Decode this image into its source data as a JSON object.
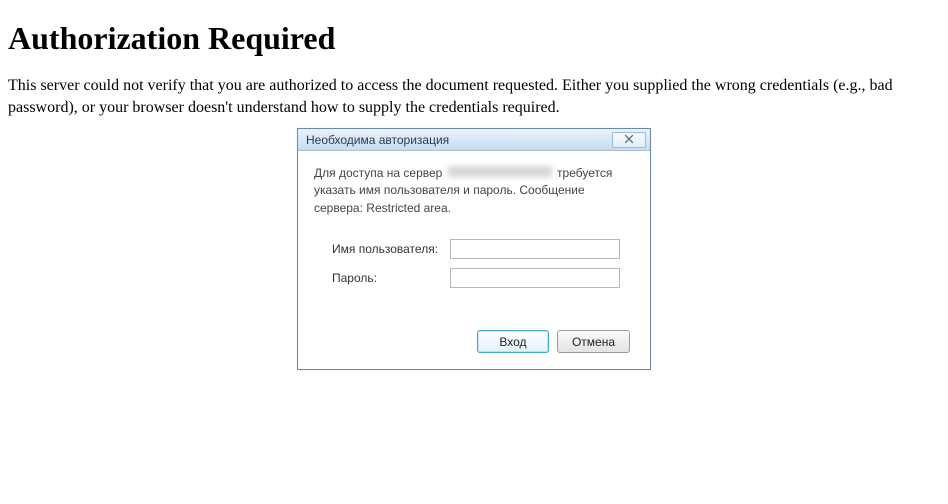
{
  "page": {
    "heading": "Authorization Required",
    "message": "This server could not verify that you are authorized to access the document requested. Either you supplied the wrong credentials (e.g., bad password), or your browser doesn't understand how to supply the credentials required."
  },
  "dialog": {
    "title": "Необходима авторизация",
    "message_pre": "Для доступа на сервер ",
    "message_post": " требуется указать имя пользователя и пароль. Сообщение сервера: Restricted area.",
    "username_label": "Имя пользователя:",
    "password_label": "Пароль:",
    "username_value": "",
    "password_value": "",
    "ok_label": "Вход",
    "cancel_label": "Отмена"
  }
}
